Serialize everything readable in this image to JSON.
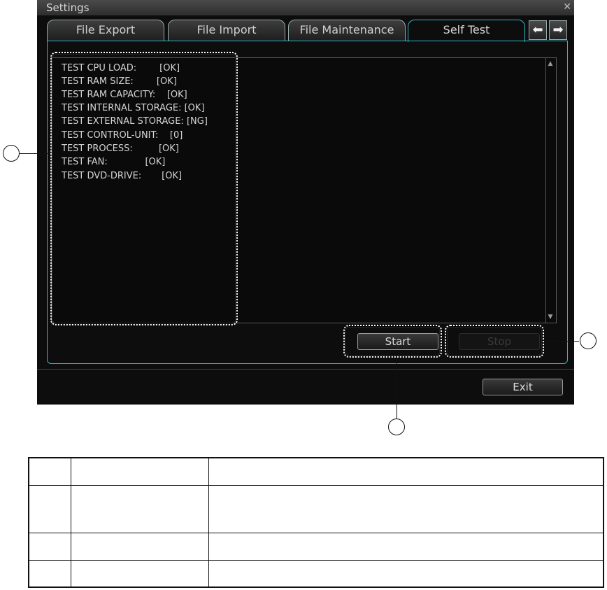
{
  "window": {
    "title": "Settings",
    "close_icon": "close-icon"
  },
  "tabs": [
    {
      "label": "File Export",
      "active": false
    },
    {
      "label": "File Import",
      "active": false
    },
    {
      "label": "File Maintenance",
      "active": false
    },
    {
      "label": "Self Test",
      "active": true
    }
  ],
  "tab_nav": {
    "prev_icon": "arrow-left-icon",
    "next_icon": "arrow-right-icon"
  },
  "results": [
    "TEST CPU LOAD:        [OK]",
    "TEST RAM SIZE:        [OK]",
    "TEST RAM CAPACITY:    [OK]",
    "TEST INTERNAL STORAGE: [OK]",
    "TEST EXTERNAL STORAGE: [NG]",
    "TEST CONTROL-UNIT:    [0]",
    "TEST PROCESS:         [OK]",
    "TEST FAN:             [OK]",
    "TEST DVD-DRIVE:       [OK]"
  ],
  "buttons": {
    "start": "Start",
    "stop": "Stop",
    "exit": "Exit"
  },
  "colors": {
    "accent": "#33b6c6",
    "background": "#0d0d0d",
    "text": "#d4d4d4"
  }
}
